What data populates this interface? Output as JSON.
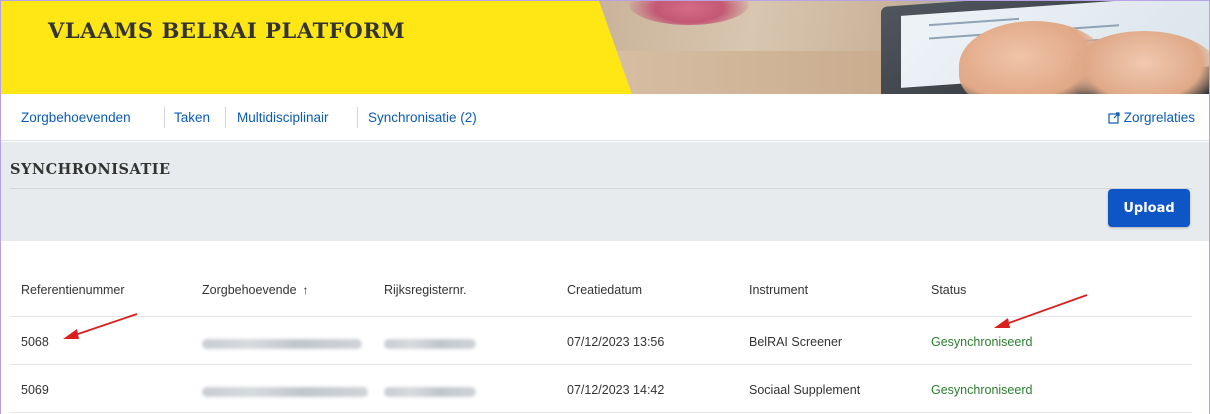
{
  "app": {
    "brand": "VLAAMS BELRAI PLATFORM"
  },
  "nav": {
    "items": [
      {
        "label": "Zorgbehoevenden"
      },
      {
        "label": "Taken"
      },
      {
        "label": "Multidisciplinair"
      },
      {
        "label": "Synchronisatie (2)"
      }
    ],
    "right_link": {
      "label": "Zorgrelaties",
      "icon": "external-link-icon"
    }
  },
  "section": {
    "title": "SYNCHRONISATIE",
    "upload_label": "Upload"
  },
  "table": {
    "columns": [
      "Referentienummer",
      "Zorgbehoevende",
      "Rijksregisternr.",
      "Creatiedatum",
      "Instrument",
      "Status"
    ],
    "sort": {
      "column": "Zorgbehoevende",
      "icon": "arrow-up-icon",
      "glyph": "↑"
    },
    "rows": [
      {
        "ref": "5068",
        "date": "07/12/2023 13:56",
        "instrument": "BelRAI Screener",
        "status": "Gesynchroniseerd"
      },
      {
        "ref": "5069",
        "date": "07/12/2023 14:42",
        "instrument": "Sociaal Supplement",
        "status": "Gesynchroniseerd"
      }
    ]
  },
  "colors": {
    "brand_yellow": "#ffe615",
    "link_blue": "#0b5bb5",
    "button_blue": "#0e55c5",
    "status_green": "#2c7d2e",
    "annotation_red": "#d9201f"
  }
}
